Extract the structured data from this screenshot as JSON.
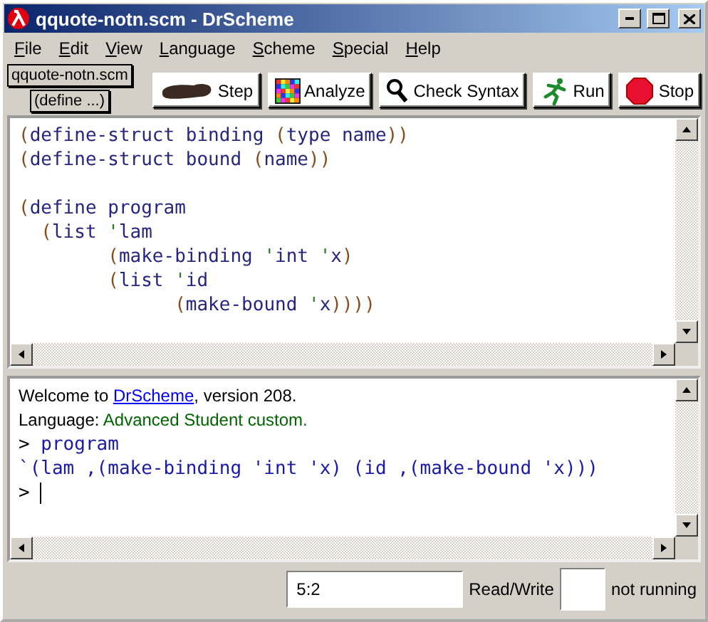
{
  "window": {
    "title": "qquote-notn.scm - DrScheme"
  },
  "menu": [
    {
      "label": "File"
    },
    {
      "label": "Edit"
    },
    {
      "label": "View"
    },
    {
      "label": "Language"
    },
    {
      "label": "Scheme"
    },
    {
      "label": "Special"
    },
    {
      "label": "Help"
    }
  ],
  "toolbar": {
    "file_button": "qquote-notn.scm",
    "define_menu": "(define ...)",
    "buttons": [
      {
        "label": "Step",
        "kind": "step"
      },
      {
        "label": "Analyze",
        "kind": "analyze"
      },
      {
        "label": "Check Syntax",
        "kind": "check"
      },
      {
        "label": "Run",
        "kind": "run"
      },
      {
        "label": "Stop",
        "kind": "stop"
      }
    ]
  },
  "editor": {
    "lines": [
      {
        "kind": "code",
        "tokens": [
          {
            "text": "(",
            "kind": "paren"
          },
          {
            "text": "define-struct binding ",
            "kind": "symbol"
          },
          {
            "text": "(",
            "kind": "paren"
          },
          {
            "text": "type name",
            "kind": "symbol"
          },
          {
            "text": "))",
            "kind": "paren"
          }
        ]
      },
      {
        "kind": "code",
        "tokens": [
          {
            "text": "(",
            "kind": "paren"
          },
          {
            "text": "define-struct bound ",
            "kind": "symbol"
          },
          {
            "text": "(",
            "kind": "paren"
          },
          {
            "text": "name",
            "kind": "symbol"
          },
          {
            "text": "))",
            "kind": "paren"
          }
        ]
      },
      {
        "kind": "blank"
      },
      {
        "kind": "code",
        "tokens": [
          {
            "text": "(",
            "kind": "paren"
          },
          {
            "text": "define program",
            "kind": "symbol"
          }
        ]
      },
      {
        "kind": "code",
        "tokens": [
          {
            "text": "  (",
            "kind": "paren"
          },
          {
            "text": "list ",
            "kind": "symbol"
          },
          {
            "text": "'",
            "kind": "quote"
          },
          {
            "text": "lam",
            "kind": "symbol"
          }
        ]
      },
      {
        "kind": "code",
        "tokens": [
          {
            "text": "        (",
            "kind": "paren"
          },
          {
            "text": "make-binding ",
            "kind": "symbol"
          },
          {
            "text": "'",
            "kind": "quote"
          },
          {
            "text": "int ",
            "kind": "symbol"
          },
          {
            "text": "'",
            "kind": "quote"
          },
          {
            "text": "x",
            "kind": "symbol"
          },
          {
            "text": ")",
            "kind": "paren"
          }
        ]
      },
      {
        "kind": "code",
        "tokens": [
          {
            "text": "        (",
            "kind": "paren"
          },
          {
            "text": "list ",
            "kind": "symbol"
          },
          {
            "text": "'",
            "kind": "quote"
          },
          {
            "text": "id",
            "kind": "symbol"
          }
        ]
      },
      {
        "kind": "code",
        "tokens": [
          {
            "text": "              (",
            "kind": "paren"
          },
          {
            "text": "make-bound ",
            "kind": "symbol"
          },
          {
            "text": "'",
            "kind": "quote"
          },
          {
            "text": "x",
            "kind": "symbol"
          },
          {
            "text": "))))",
            "kind": "paren"
          }
        ]
      }
    ]
  },
  "interactions": {
    "welcome": {
      "prefix": "Welcome to ",
      "link": "DrScheme",
      "suffix": ", version 208."
    },
    "language": {
      "label": "Language: ",
      "value": "Advanced Student custom."
    },
    "lines": [
      {
        "prompt": ">",
        "text": "program"
      },
      {
        "text": "`(lam ,(make-binding 'int 'x) (id ,(make-bound 'x)))"
      },
      {
        "prompt": ">",
        "cursor": true
      }
    ]
  },
  "status_bar": {
    "position": "5:2",
    "mode": "Read/Write",
    "state": "not running"
  }
}
